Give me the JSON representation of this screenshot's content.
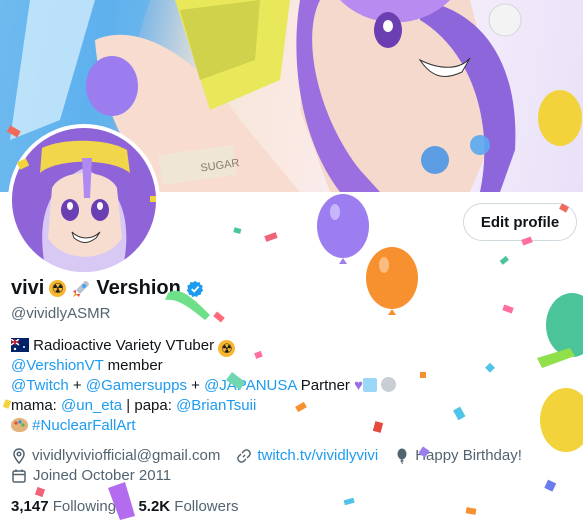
{
  "profile": {
    "display_name": "vivi",
    "name_suffix": "Vershion",
    "handle": "@vividlyASMR",
    "edit_button": "Edit profile"
  },
  "bio": {
    "line1": "Radioactive Variety VTuber",
    "line2_link": "@VershionVT",
    "line2_text": " member",
    "line3_link1": "@Twitch",
    "line3_sep1": " + ",
    "line3_link2": "@Gamersupps",
    "line3_sep2": " + ",
    "line3_link3": "@JAPANUSA",
    "line3_text": " Partner",
    "line4_text1": "mama: ",
    "line4_link1": "@un_eta",
    "line4_text2": " | papa: ",
    "line4_link2": "@BrianTsuii",
    "line5_link": "#NuclearFallArt"
  },
  "meta": {
    "email": "vividlyviviofficial@gmail.com",
    "website": "twitch.tv/vividlyvivi",
    "birthday": "Happy Birthday!",
    "joined": "Joined October 2011"
  },
  "stats": {
    "following_count": "3,147",
    "following_label": "Following",
    "followers_count": "5.2K",
    "followers_label": "Followers"
  },
  "colors": {
    "link": "#1d9bf0",
    "muted": "#536471",
    "text": "#0f1419",
    "verified": "#1d9bf0"
  },
  "icons": [
    "australia-flag-icon",
    "radioactive-icon",
    "rocket-icon",
    "verified-badge-icon",
    "location-icon",
    "link-icon",
    "balloon-icon",
    "calendar-icon",
    "palette-icon"
  ]
}
